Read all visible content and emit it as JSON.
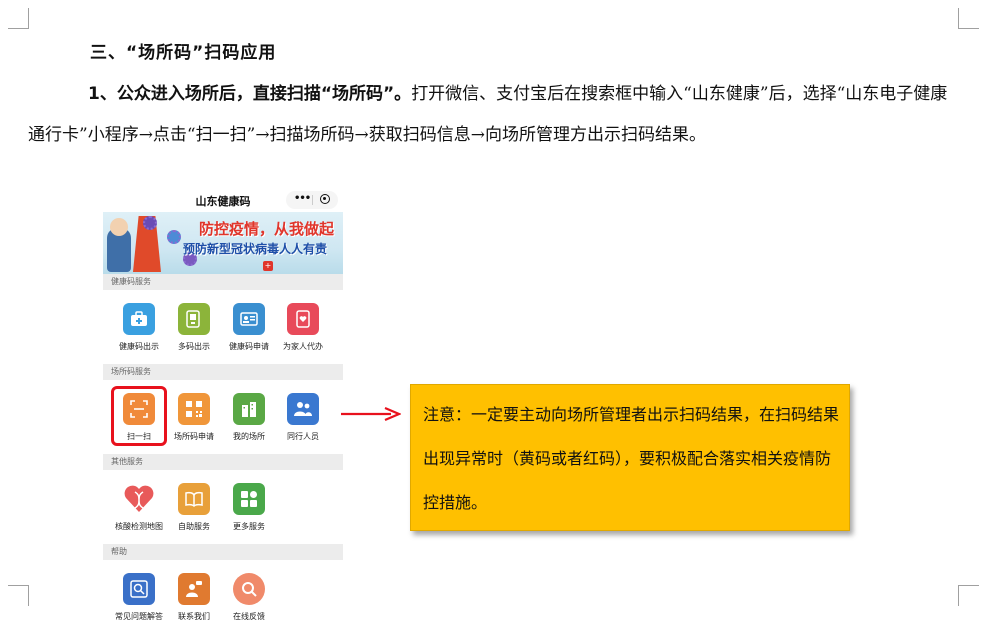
{
  "heading": "三、“场所码”扫码应用",
  "paragraph": {
    "lead": "1、公众进入场所后，直接扫描“场所码”。",
    "body": "打开微信、支付宝后在搜索框中输入“山东健康”后，选择“山东电子健康通行卡”小程序→点击“扫一扫”→扫描场所码→获取扫码信息→向场所管理方出示扫码结果。"
  },
  "phone": {
    "title": "山东健康码",
    "capsule_more": "•••",
    "banner": {
      "slogan1": "防控疫情，从我做起",
      "slogan2": "预防新型冠状病毒人人有责"
    },
    "sections": [
      {
        "title": "健康码服务",
        "items": [
          {
            "label": "健康码出示",
            "icon": "medical-bag-icon",
            "color": "#3aa0e0"
          },
          {
            "label": "多码出示",
            "icon": "multi-code-icon",
            "color": "#8cb43a"
          },
          {
            "label": "健康码申请",
            "icon": "id-card-icon",
            "color": "#3a8fd0"
          },
          {
            "label": "为家人代办",
            "icon": "phone-heart-icon",
            "color": "#e84a5a"
          }
        ]
      },
      {
        "title": "场所码服务",
        "items": [
          {
            "label": "扫一扫",
            "icon": "scan-icon",
            "color": "#f08a3a"
          },
          {
            "label": "场所码申请",
            "icon": "qr-code-icon",
            "color": "#f0963a"
          },
          {
            "label": "我的场所",
            "icon": "building-icon",
            "color": "#5aa845"
          },
          {
            "label": "同行人员",
            "icon": "people-icon",
            "color": "#3a78d0"
          }
        ]
      },
      {
        "title": "其他服务",
        "items": [
          {
            "label": "核酸检测地图",
            "icon": "dna-heart-icon",
            "color": "#e85a5a"
          },
          {
            "label": "自助服务",
            "icon": "book-icon",
            "color": "#e8a03a"
          },
          {
            "label": "更多服务",
            "icon": "grid-icon",
            "color": "#4aa84a"
          }
        ]
      },
      {
        "title": "帮助",
        "items": [
          {
            "label": "常见问题解答",
            "icon": "faq-icon",
            "color": "#3a70c8"
          },
          {
            "label": "联系我们",
            "icon": "contact-icon",
            "color": "#e07a30"
          },
          {
            "label": "在线反馈",
            "icon": "feedback-icon",
            "color": "#f08a6a"
          }
        ]
      }
    ]
  },
  "note": "注意：一定要主动向场所管理者出示扫码结果，在扫码结果出现异常时（黄码或者红码），要积极配合落实相关疫情防控措施。"
}
